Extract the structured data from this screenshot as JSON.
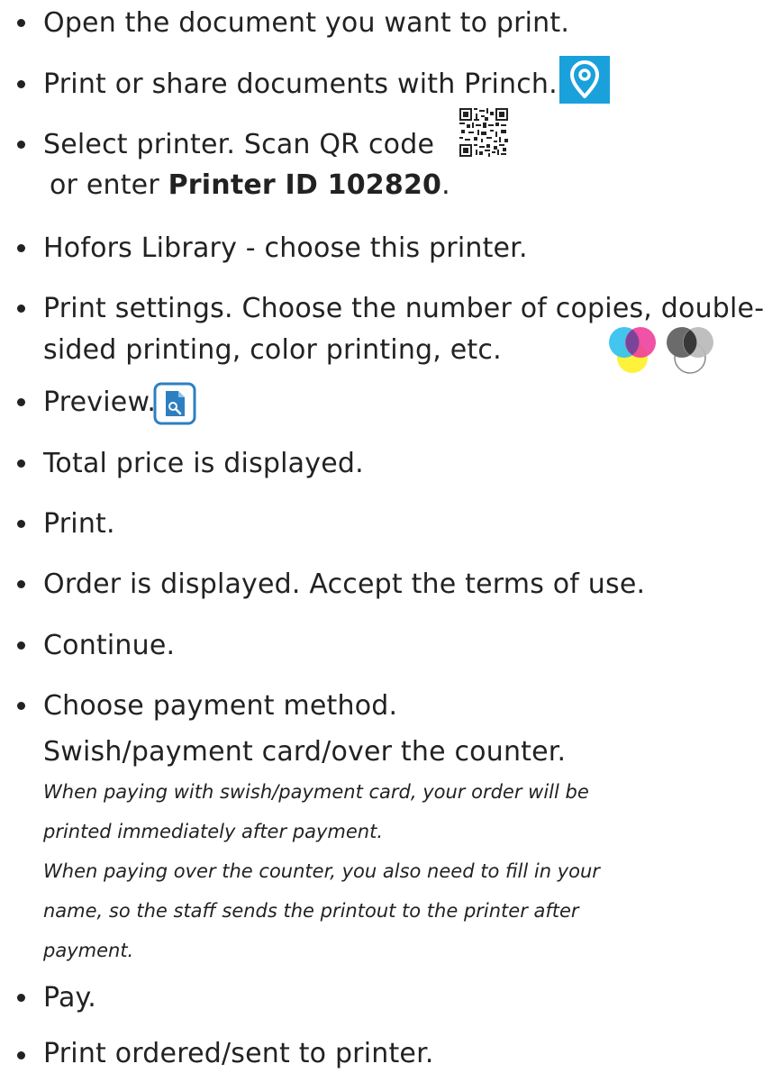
{
  "steps": [
    {
      "text": "Open the document you want to print."
    },
    {
      "text": "Print or share documents with Princh.",
      "icon": "princh-location-icon"
    },
    {
      "text": "Select printer. Scan QR code",
      "icon": "qr-code-icon",
      "line2_prefix": "or enter ",
      "line2_bold": "Printer ID 102820",
      "line2_suffix": "."
    },
    {
      "text": "Hofors Library - choose this printer."
    },
    {
      "text": "Print settings. Choose the number of copies, double-",
      "line2": "sided printing, color printing, etc.",
      "icons": [
        "color-print-icon",
        "black-white-print-icon"
      ]
    },
    {
      "text": "Preview.",
      "icon": "document-preview-icon"
    },
    {
      "text": "Total price is displayed."
    },
    {
      "text": "Print."
    },
    {
      "text": "Order is displayed. Accept the terms of use."
    },
    {
      "text": "Continue."
    },
    {
      "text": "Choose payment method.",
      "line2": "Swish/payment card/over the counter.",
      "notes": [
        "When paying with swish/payment card, your order will be",
        "printed immediately after payment.",
        "When paying over the counter, you also need to fill in your",
        "name, so the staff sends the printout to the printer after",
        "payment."
      ]
    },
    {
      "text": "Pay."
    },
    {
      "text": "Print ordered/sent to printer."
    }
  ],
  "colors": {
    "text": "#222222",
    "princh_blue": "#1aa1dc",
    "preview_blue": "#2e7fc0",
    "cyan": "#38c3ee",
    "magenta": "#ee3f9c",
    "yellow": "#fff23a",
    "grey": "#6b6b6b"
  }
}
